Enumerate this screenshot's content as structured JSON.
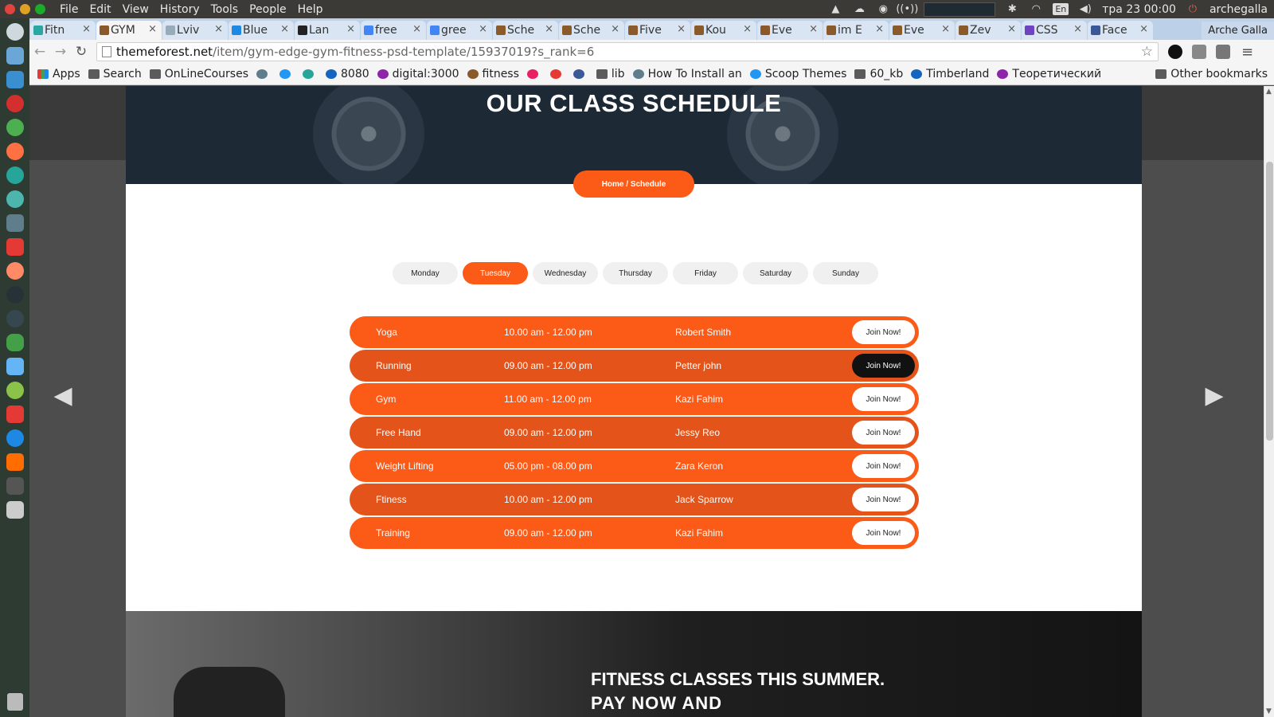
{
  "os": {
    "menu": [
      "File",
      "Edit",
      "View",
      "History",
      "Tools",
      "People",
      "Help"
    ],
    "lang": "En",
    "clock": "тра 23 00:00",
    "user": "archegalla"
  },
  "browser": {
    "tabs": [
      {
        "label": "Fitn",
        "active": false,
        "color": "#2aa7a0"
      },
      {
        "label": "GYM",
        "active": true,
        "color": "#8b5a2b"
      },
      {
        "label": "Lviv",
        "active": false,
        "color": "#9ab"
      },
      {
        "label": "Blue",
        "active": false,
        "color": "#1e88e5"
      },
      {
        "label": "Lan",
        "active": false,
        "color": "#222"
      },
      {
        "label": "free",
        "active": false,
        "color": "#4285f4"
      },
      {
        "label": "gree",
        "active": false,
        "color": "#4285f4"
      },
      {
        "label": "Sche",
        "active": false,
        "color": "#8b5a2b"
      },
      {
        "label": "Sche",
        "active": false,
        "color": "#8b5a2b"
      },
      {
        "label": "Five",
        "active": false,
        "color": "#8b5a2b"
      },
      {
        "label": "Kou",
        "active": false,
        "color": "#8b5a2b"
      },
      {
        "label": "Eve",
        "active": false,
        "color": "#8b5a2b"
      },
      {
        "label": "im E",
        "active": false,
        "color": "#8b5a2b"
      },
      {
        "label": "Eve",
        "active": false,
        "color": "#8b5a2b"
      },
      {
        "label": "Zev",
        "active": false,
        "color": "#8b5a2b"
      },
      {
        "label": "CSS",
        "active": false,
        "color": "#6f42c1"
      },
      {
        "label": "Face",
        "active": false,
        "color": "#3b5998"
      }
    ],
    "profile": "Arche Galla",
    "url_domain": "themeforest.net",
    "url_path": "/item/gym-edge-gym-fitness-psd-template/15937019?s_rank=6",
    "bookmarks": [
      "Apps",
      "Search",
      "OnLineCourses",
      "",
      "",
      "",
      "8080",
      "digital:3000",
      "fitness",
      "",
      "",
      "",
      "lib",
      "How To Install an",
      "Scoop Themes",
      "60_kb",
      "Timberland",
      "Теоретический"
    ],
    "other_bookmarks": "Other bookmarks"
  },
  "page": {
    "hero_title": "OUR CLASS SCHEDULE",
    "breadcrumb": "Home / Schedule",
    "days": [
      "Monday",
      "Tuesday",
      "Wednesday",
      "Thursday",
      "Friday",
      "Saturday",
      "Sunday"
    ],
    "active_day": "Tuesday",
    "schedule": [
      {
        "class": "Yoga",
        "time": "10.00 am - 12.00 pm",
        "trainer": "Robert Smith",
        "button": "Join Now!"
      },
      {
        "class": "Running",
        "time": "09.00 am - 12.00 pm",
        "trainer": "Petter john",
        "button": "Join Now!"
      },
      {
        "class": "Gym",
        "time": "11.00 am - 12.00 pm",
        "trainer": "Kazi Fahim",
        "button": "Join Now!"
      },
      {
        "class": "Free Hand",
        "time": "09.00 am - 12.00 pm",
        "trainer": "Jessy Reo",
        "button": "Join Now!"
      },
      {
        "class": "Weight Lifting",
        "time": "05.00 pm - 08.00 pm",
        "trainer": "Zara Keron",
        "button": "Join Now!"
      },
      {
        "class": "Ftiness",
        "time": "10.00 am - 12.00 pm",
        "trainer": "Jack Sparrow",
        "button": "Join Now!"
      },
      {
        "class": "Training",
        "time": "09.00 am - 12.00 pm",
        "trainer": "Kazi Fahim",
        "button": "Join Now!"
      }
    ],
    "promo_title": "FITNESS CLASSES THIS SUMMER.",
    "promo_sub": "PAY NOW AND",
    "accent_color": "#fb5a17"
  }
}
